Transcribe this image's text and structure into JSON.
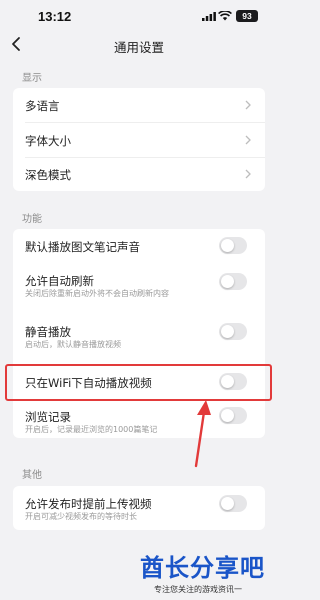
{
  "status_bar": {
    "time": "13:12",
    "battery": "93"
  },
  "header": {
    "title": "通用设置"
  },
  "sections": [
    {
      "label": "显示",
      "items": [
        {
          "label": "多语言",
          "control": "chevron"
        },
        {
          "label": "字体大小",
          "control": "chevron"
        },
        {
          "label": "深色模式",
          "control": "chevron"
        }
      ]
    },
    {
      "label": "功能",
      "items": [
        {
          "label": "默认播放图文笔记声音",
          "control": "toggle",
          "enabled": false
        },
        {
          "label": "允许自动刷新",
          "sublabel": "关闭后除重新启动外将不会自动刷新内容",
          "control": "toggle",
          "enabled": false
        },
        {
          "label": "静音播放",
          "sublabel": "启动后，默认静音播放视频",
          "control": "toggle",
          "enabled": false
        },
        {
          "label": "只在WiFi下自动播放视频",
          "control": "toggle",
          "enabled": false
        },
        {
          "label": "浏览记录",
          "sublabel": "开启后，记录最近浏览的1000篇笔记",
          "control": "toggle",
          "enabled": false
        }
      ]
    },
    {
      "label": "其他",
      "items": [
        {
          "label": "允许发布时提前上传视频",
          "sublabel": "开启可减少视频发布的等待时长",
          "control": "toggle",
          "enabled": false
        }
      ]
    }
  ],
  "annotation": {
    "highlight_color": "#e23a3a"
  },
  "watermark": {
    "title": "酋长分享吧",
    "subtitle": "专注您关注的游戏资讯一"
  },
  "colors": {
    "background": "#f2f2f4",
    "toggle_off": "#e6e6e8",
    "watermark": "#1a55c8"
  }
}
